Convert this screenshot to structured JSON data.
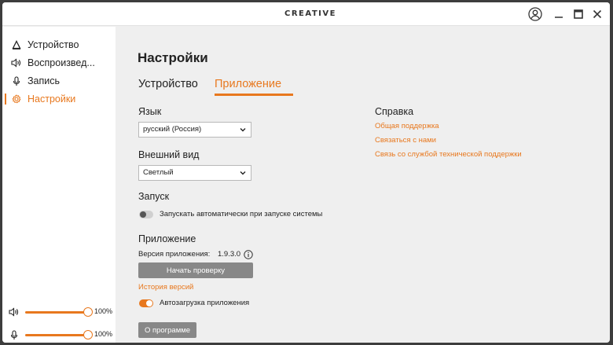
{
  "titlebar": {
    "logo": "CREATIVE"
  },
  "sidebar": {
    "items": [
      {
        "label": "Устройство",
        "icon": "device-icon"
      },
      {
        "label": "Воспроизвед...",
        "icon": "speaker-icon"
      },
      {
        "label": "Запись",
        "icon": "microphone-icon"
      },
      {
        "label": "Настройки",
        "icon": "gear-icon"
      }
    ],
    "playback_volume": "100%",
    "playback_level": 1.0,
    "record_volume": "100%",
    "record_level": 1.0
  },
  "main": {
    "title": "Настройки",
    "tabs": [
      {
        "label": "Устройство"
      },
      {
        "label": "Приложение"
      }
    ],
    "language": {
      "label": "Язык",
      "value": "русский (Россия)"
    },
    "appearance": {
      "label": "Внешний вид",
      "value": "Светлый"
    },
    "startup": {
      "label": "Запуск",
      "toggle_label": "Запускать автоматически при запуске системы",
      "toggle_on": false
    },
    "application": {
      "label": "Приложение",
      "version_label": "Версия приложения:",
      "version": "1.9.3.0",
      "check_button": "Начать проверку",
      "history_link": "История версий",
      "autoupdate_label": "Автозагрузка приложения",
      "autoupdate_on": true,
      "about_button": "О программе"
    },
    "help": {
      "label": "Справка",
      "links": [
        "Общая поддержка",
        "Связаться с нами",
        "Связь со службой технической поддержки"
      ]
    }
  },
  "colors": {
    "accent": "#e8781e",
    "button": "#888888"
  }
}
